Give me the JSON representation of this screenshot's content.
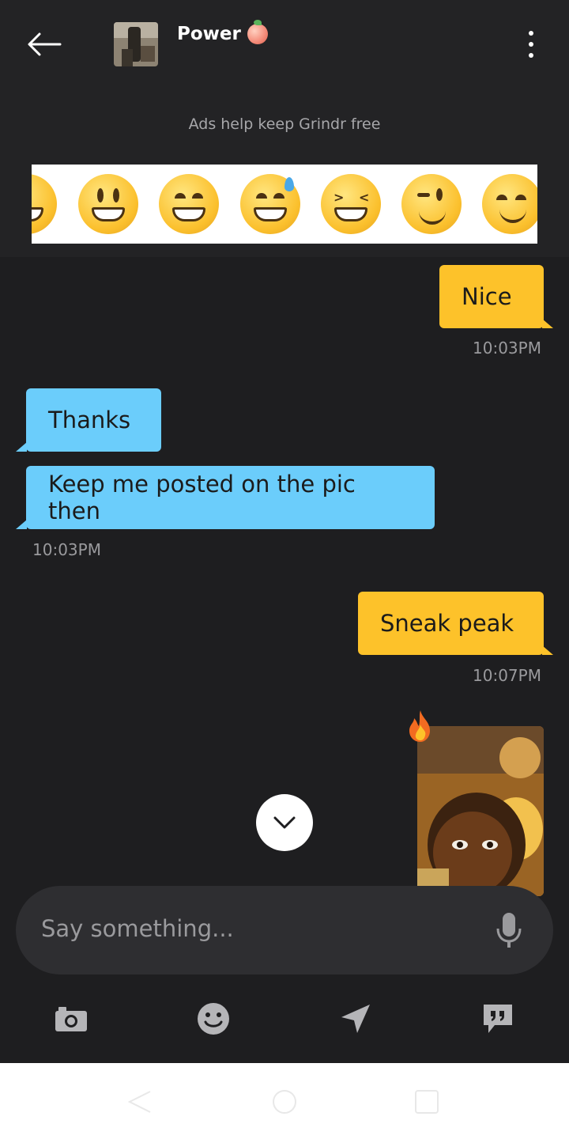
{
  "header": {
    "contact_name": "Power",
    "ad_label": "Ads help keep Grindr free"
  },
  "messages": [
    {
      "side": "sent",
      "text": "Nice",
      "time": "10:03PM"
    },
    {
      "side": "received",
      "text": "Thanks"
    },
    {
      "side": "received",
      "text": "Keep me posted on the pic then",
      "time": "10:03PM"
    },
    {
      "side": "sent",
      "text": "Sneak peak",
      "time": "10:07PM"
    },
    {
      "side": "sent",
      "type": "photo",
      "reaction": "fire-icon"
    }
  ],
  "composer": {
    "placeholder": "Say something..."
  },
  "toolbar": {
    "icons": [
      "camera-icon",
      "emoji-icon",
      "location-icon",
      "saved-phrases-icon"
    ]
  },
  "colors": {
    "background": "#1e1e20",
    "sent_bubble": "#fdc22a",
    "received_bubble": "#6bcdfb"
  }
}
